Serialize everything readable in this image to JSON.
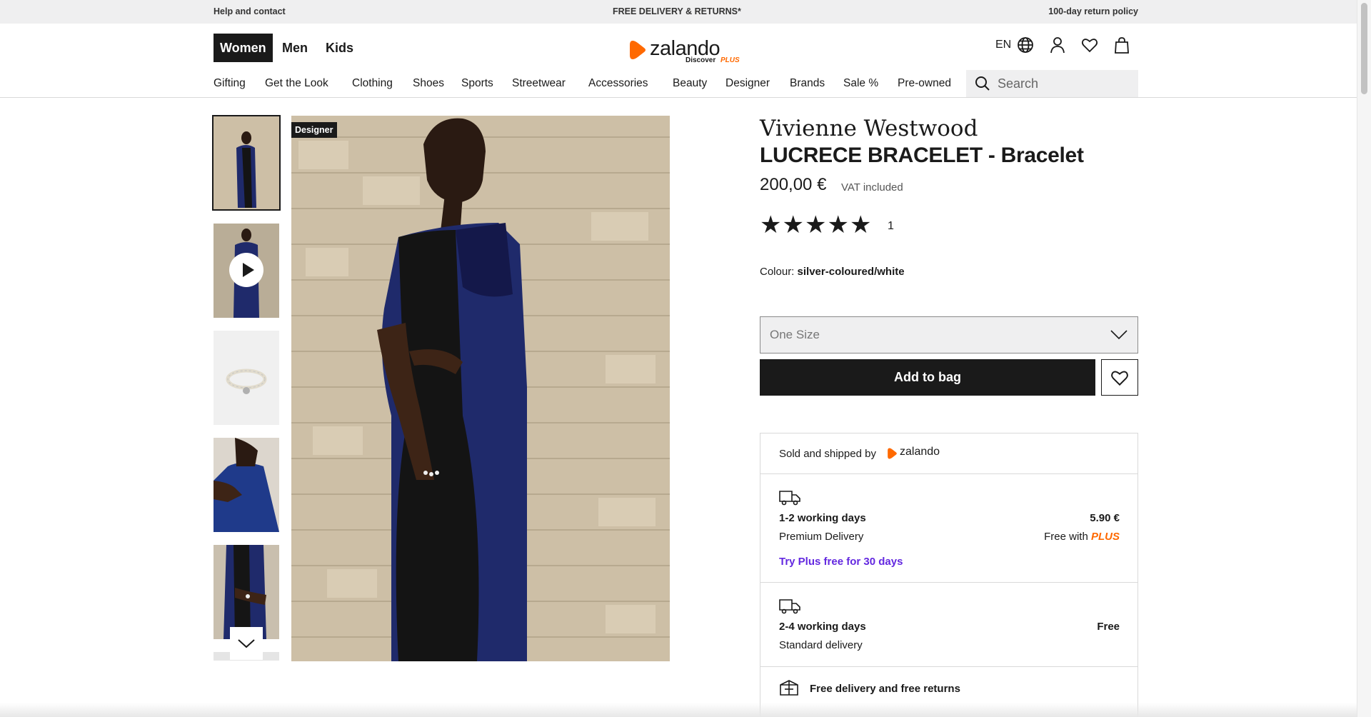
{
  "topbar": {
    "help": "Help and contact",
    "delivery": "FREE DELIVERY & RETURNS*",
    "returns": "100-day return policy"
  },
  "header": {
    "genders": [
      "Women",
      "Men",
      "Kids"
    ],
    "active_gender": "Women",
    "logo": {
      "word": "zalando",
      "discover": "Discover",
      "plus": "PLUS"
    },
    "language": "EN",
    "icons": [
      "globe-icon",
      "user-icon",
      "heart-icon",
      "bag-icon"
    ]
  },
  "nav": {
    "categories": [
      "Gifting",
      "Get the Look",
      "Clothing",
      "Shoes",
      "Sports",
      "Streetwear",
      "Accessories",
      "Beauty",
      "Designer",
      "Brands",
      "Sale %",
      "Pre-owned"
    ],
    "search_placeholder": "Search"
  },
  "gallery": {
    "badge": "Designer",
    "thumbnails": [
      "model-full",
      "model-video",
      "bracelet-product",
      "model-arm",
      "model-wrist"
    ]
  },
  "product": {
    "brand": "Vivienne Westwood",
    "name": "LUCRECE BRACELET - Bracelet",
    "price": "200,00 €",
    "vat": "VAT included",
    "rating_stars": 5,
    "review_count": "1",
    "colour_label": "Colour:",
    "colour_value": "silver-coloured/white",
    "size": "One Size",
    "add_to_bag": "Add to bag"
  },
  "delivery": {
    "sold_by": "Sold and shipped by",
    "seller": "zalando",
    "premium": {
      "days": "1-2 working days",
      "type": "Premium Delivery",
      "price": "5.90 €",
      "free_with": "Free with",
      "plus": "PLUS",
      "try_plus": "Try Plus free for 30 days"
    },
    "standard": {
      "days": "2-4 working days",
      "type": "Standard delivery",
      "price": "Free"
    },
    "free_returns": "Free delivery and free returns"
  },
  "colors": {
    "brand_orange": "#ff6900",
    "plus_purple": "#6328e0",
    "primary": "#1a1a1a"
  }
}
